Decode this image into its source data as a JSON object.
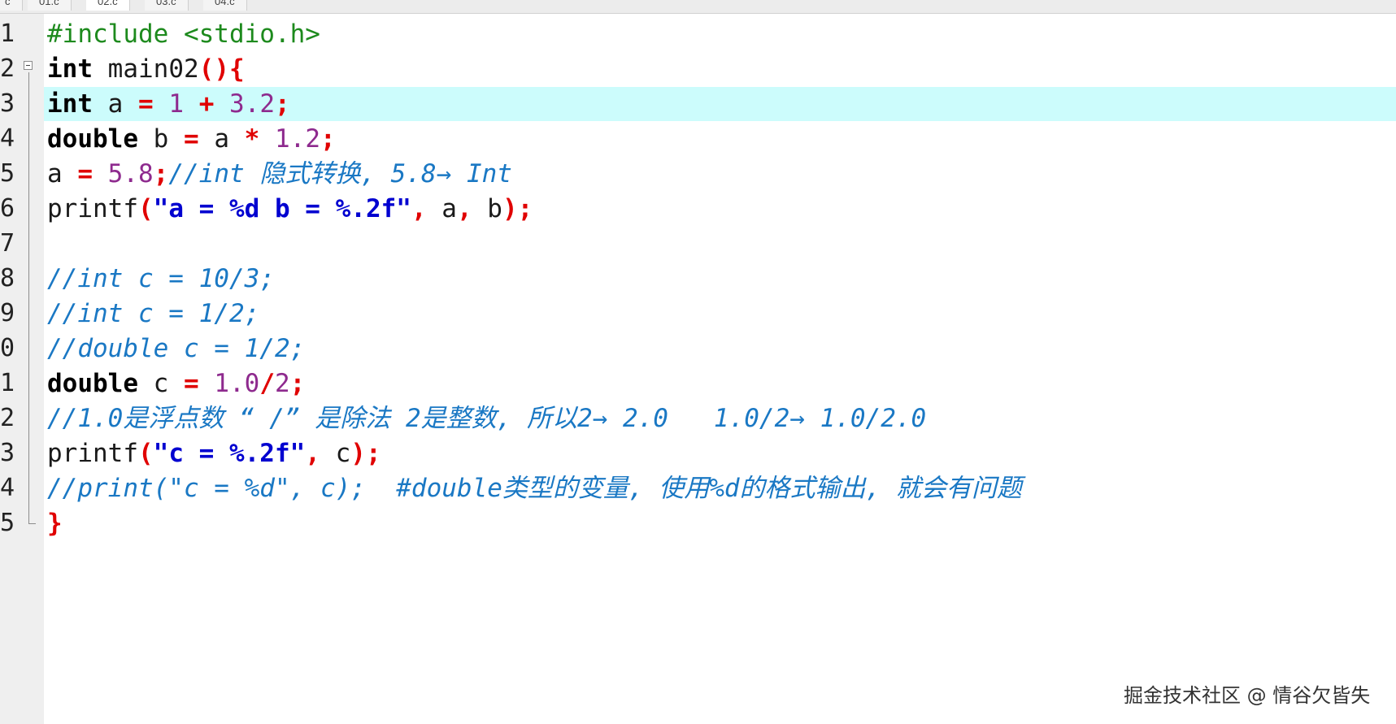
{
  "tabs": [
    {
      "label": "c"
    },
    {
      "label": "01.c"
    },
    {
      "label": "02.c"
    },
    {
      "label": "03.c"
    },
    {
      "label": "04.c"
    }
  ],
  "line_numbers": [
    "1",
    "2",
    "3",
    "4",
    "5",
    "6",
    "7",
    "8",
    "9",
    "0",
    "1",
    "2",
    "3",
    "4",
    "5"
  ],
  "code": {
    "l1": {
      "include": "#include <stdio.h>"
    },
    "l2": {
      "kw": "int",
      "name": " main02",
      "paren_open": "(",
      "paren_close": ")",
      "brace": "{"
    },
    "l3": {
      "kw": "int",
      "var": " a ",
      "eq": "=",
      "sp1": " ",
      "n1": "1",
      "sp2": " ",
      "plus": "+",
      "sp3": " ",
      "n2": "3.2",
      "semi": ";"
    },
    "l4": {
      "kw": "double",
      "var": " b ",
      "eq": "=",
      "var2": " a ",
      "mul": "*",
      "sp": " ",
      "n1": "1.2",
      "semi": ";"
    },
    "l5": {
      "var": "a ",
      "eq": "=",
      "sp": " ",
      "n1": "5.8",
      "semi": ";",
      "comment": "//int 隐式转换, 5.8→ Int"
    },
    "l6": {
      "fn": "printf",
      "paren_open": "(",
      "str": "\"a = %d b = %.2f\"",
      "comma1": ",",
      "a1": " a",
      "comma2": ",",
      "a2": " b",
      "paren_close": ")",
      "semi": ";"
    },
    "l8": {
      "comment": "//int c = 10/3;"
    },
    "l9": {
      "comment": "//int c = 1/2;"
    },
    "l10": {
      "comment": "//double c = 1/2;"
    },
    "l11": {
      "kw": "double",
      "var": " c ",
      "eq": "=",
      "sp": " ",
      "n1": "1.0",
      "div": "/",
      "n2": "2",
      "semi": ";"
    },
    "l12": {
      "comment": "//1.0是浮点数 “ /” 是除法 2是整数, 所以2→ 2.0   1.0/2→ 1.0/2.0"
    },
    "l13": {
      "fn": "printf",
      "paren_open": "(",
      "str": "\"c = %.2f\"",
      "comma": ",",
      "a1": " c",
      "paren_close": ")",
      "semi": ";"
    },
    "l14": {
      "comment": "//print(\"c = %d\", c);  #double类型的变量, 使用%d的格式输出, 就会有问题"
    },
    "l15": {
      "brace": "}"
    }
  },
  "watermark": "掘金技术社区 @ 情谷欠皆失",
  "colors": {
    "keyword": "#000000",
    "preprocessor": "#1d8a1d",
    "number": "#8e2a8e",
    "operator": "#e00000",
    "string": "#0000d0",
    "comment": "#1a78c4",
    "current_line": "#ccfcfc",
    "gutter": "#efefef"
  }
}
